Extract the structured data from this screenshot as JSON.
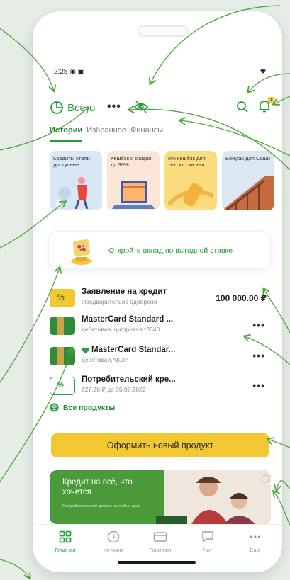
{
  "status": {
    "time": "2:25",
    "icons": "◉ ▣"
  },
  "header": {
    "total_label": "Всего",
    "more": "•••",
    "notification_count": "1"
  },
  "tabs": [
    {
      "label": "Истории",
      "active": true
    },
    {
      "label": "Избранное",
      "active": false
    },
    {
      "label": "Финансы",
      "active": false
    }
  ],
  "stories": [
    {
      "text": "Кредиты стали доступнее",
      "bg": "#d9e6f3"
    },
    {
      "text": "Кешбэк и скидки до 30%",
      "bg": "#fbe5d6"
    },
    {
      "text": "5% кешбэк для тех, кто на авто",
      "bg": "#fbdc7e"
    },
    {
      "text": "Бонусы для Саши",
      "bg": "#dbe8f2"
    }
  ],
  "promo": {
    "text": "Откройте вклад по выгодной ставке"
  },
  "products": [
    {
      "name": "Заявление на кредит",
      "sub": "Предварительно одобрено",
      "amount": "100 000.00 ₽",
      "more": ""
    },
    {
      "name": "MasterCard Standard ...",
      "sub": "дебетовая, цифровая,*3340",
      "amount": "",
      "more": "•••"
    },
    {
      "name": "MasterCard Standar...",
      "sub": "дебетовая,*0037",
      "amount": "",
      "more": "•••"
    },
    {
      "name": "Потребительский кре...",
      "sub": "927.28 ₽ до 05.07.2022",
      "amount": "",
      "more": "•••"
    }
  ],
  "all_products": "Все продукты",
  "new_product_button": "Оформить новый продукт",
  "banner": {
    "title": "Кредит на всё, что хочется",
    "subtitle": "Потребительский кредит на любые цели"
  },
  "nav": [
    {
      "label": "Главная",
      "icon": "grid-icon",
      "active": true
    },
    {
      "label": "История",
      "icon": "clock-icon",
      "active": false
    },
    {
      "label": "Платежи",
      "icon": "card-icon",
      "active": false
    },
    {
      "label": "Чат",
      "icon": "chat-icon",
      "active": false
    },
    {
      "label": "Ещё",
      "icon": "more-icon",
      "active": false
    }
  ],
  "colors": {
    "brand_green": "#21a038",
    "accent_yellow": "#f2c832",
    "background": "#e6ece6"
  }
}
